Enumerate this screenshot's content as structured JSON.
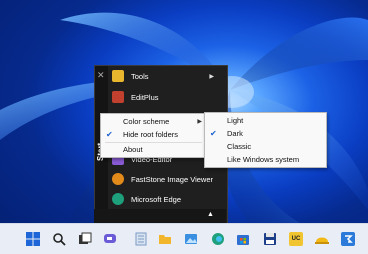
{
  "start_menu": {
    "vertical_label": "Start",
    "close_glyph": "✕",
    "items": [
      {
        "label": "Tools",
        "has_submenu": true,
        "icon": "folder-icon",
        "color": "#e8b72d"
      },
      {
        "label": "EditPlus",
        "has_submenu": false,
        "icon": "editplus-icon",
        "color": "#c2402e"
      },
      {
        "label": "Video-Editor",
        "has_submenu": false,
        "icon": "video-editor-icon",
        "color": "#8a5bd6"
      },
      {
        "label": "FastStone Image Viewer",
        "has_submenu": false,
        "icon": "faststone-icon",
        "color": "#e28a1a"
      },
      {
        "label": "Microsoft Edge",
        "has_submenu": false,
        "icon": "edge-icon",
        "color": "#1fa07c"
      }
    ],
    "collapse_glyph": "▲"
  },
  "context_menu": {
    "items": [
      {
        "label": "Color scheme",
        "checked": false,
        "has_submenu": true
      },
      {
        "label": "Hide root folders",
        "checked": true,
        "has_submenu": false
      },
      {
        "label": "About",
        "checked": false,
        "has_submenu": false
      }
    ]
  },
  "color_submenu": {
    "items": [
      {
        "label": "Light",
        "checked": false
      },
      {
        "label": "Dark",
        "checked": true
      },
      {
        "label": "Classic",
        "checked": false
      },
      {
        "label": "Like Windows system",
        "checked": false
      }
    ]
  },
  "glyphs": {
    "check": "✔",
    "submenu_arrow": "▶"
  },
  "taskbar": {
    "icons": [
      {
        "name": "start-icon",
        "color": "#1e66d8"
      },
      {
        "name": "search-icon",
        "color": "#222222"
      },
      {
        "name": "task-view-icon",
        "color": "#333333"
      },
      {
        "name": "chat-icon",
        "color": "#6b5bd6"
      },
      {
        "name": "notepad-icon",
        "color": "#7c9bc4"
      },
      {
        "name": "explorer-icon",
        "color": "#f2b62c"
      },
      {
        "name": "photos-icon",
        "color": "#3b8fe0"
      },
      {
        "name": "edge-icon",
        "color": "#1fa07c"
      },
      {
        "name": "store-icon",
        "color": "#2f6fd1"
      },
      {
        "name": "save-icon",
        "color": "#1d3f8a"
      },
      {
        "name": "uc-icon",
        "color": "#f0c531"
      },
      {
        "name": "hardhat-icon",
        "color": "#f2b916"
      },
      {
        "name": "app-icon",
        "color": "#2b79d8"
      }
    ],
    "uc_label": "UC"
  }
}
